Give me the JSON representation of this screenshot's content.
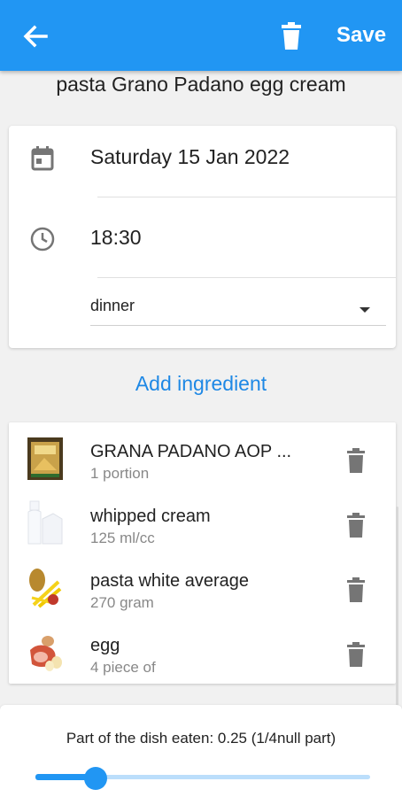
{
  "appbar": {
    "back_icon": "arrow-left-icon",
    "delete_icon": "trash-icon",
    "save_label": "Save",
    "color": "#2196f3"
  },
  "dish_title": "pasta Grano Padano egg cream",
  "datetime": {
    "date": "Saturday 15 Jan 2022",
    "date_icon": "calendar-icon",
    "time": "18:30",
    "time_icon": "clock-icon",
    "meal_type": "dinner"
  },
  "add_ingredient_label": "Add ingredient",
  "ingredients": [
    {
      "name": "GRANA PADANO AOP ...",
      "quantity": "1 portion",
      "icon": "cheese-package-image"
    },
    {
      "name": "whipped cream",
      "quantity": "125 ml/cc",
      "icon": "milk-bottles-image"
    },
    {
      "name": "pasta white average",
      "quantity": "270 gram",
      "icon": "pasta-image"
    },
    {
      "name": "egg",
      "quantity": "4 piece of",
      "icon": "ham-egg-image"
    }
  ],
  "portion": {
    "label": "Part of the dish eaten: 0.25 (1/4null part)",
    "value": 0.18
  },
  "colors": {
    "accent": "#2196f3",
    "link": "#1e88e5",
    "background": "#f1f1f1"
  }
}
